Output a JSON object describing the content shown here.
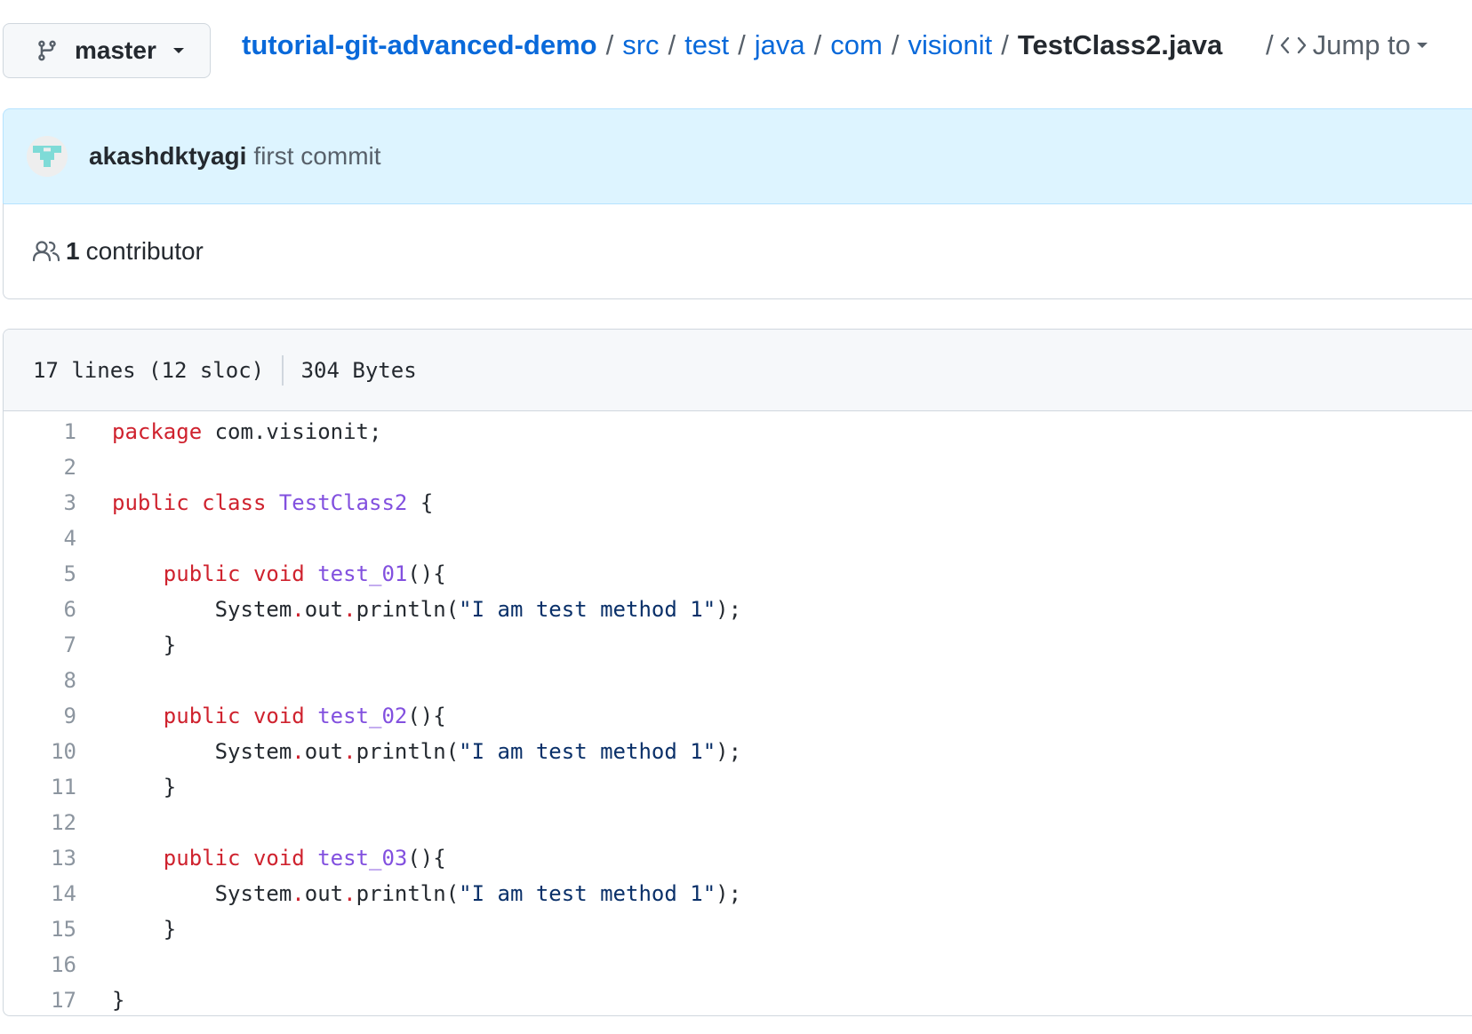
{
  "branch": {
    "label": "master"
  },
  "breadcrumb": {
    "repo": "tutorial-git-advanced-demo",
    "path": [
      "src",
      "test",
      "java",
      "com",
      "visionit"
    ],
    "file": "TestClass2.java",
    "separator": "/",
    "jump_to": "Jump to"
  },
  "commit": {
    "author": "akashdktyagi",
    "message": "first commit"
  },
  "contributors": {
    "count": "1",
    "label": "contributor"
  },
  "file_info": {
    "lines": "17 lines (12 sloc)",
    "size": "304 Bytes"
  },
  "code": {
    "line_numbers": [
      "1",
      "2",
      "3",
      "4",
      "5",
      "6",
      "7",
      "8",
      "9",
      "10",
      "11",
      "12",
      "13",
      "14",
      "15",
      "16",
      "17"
    ],
    "tokens": {
      "package_kw": "package",
      "package_name": "com.visionit;",
      "public_kw": "public",
      "class_kw": "class",
      "class_name": "TestClass2",
      "open_brace": "{",
      "close_brace": "}",
      "void_kw": "void",
      "method_1": "test_01",
      "method_2": "test_02",
      "method_3": "test_03",
      "parens_brace": "(){",
      "system": "System",
      "dot": ".",
      "out": "out",
      "println": "println(",
      "string": "\"I am test method 1\"",
      "call_end": ");"
    }
  },
  "colors": {
    "link": "#0969da",
    "keyword": "#cf222e",
    "entity": "#8250df",
    "string": "#0a3069",
    "commit_bg": "#ddf4ff"
  },
  "icons": [
    "git-branch-icon",
    "caret-down-icon",
    "code-icon",
    "people-icon",
    "avatar-identicon"
  ]
}
